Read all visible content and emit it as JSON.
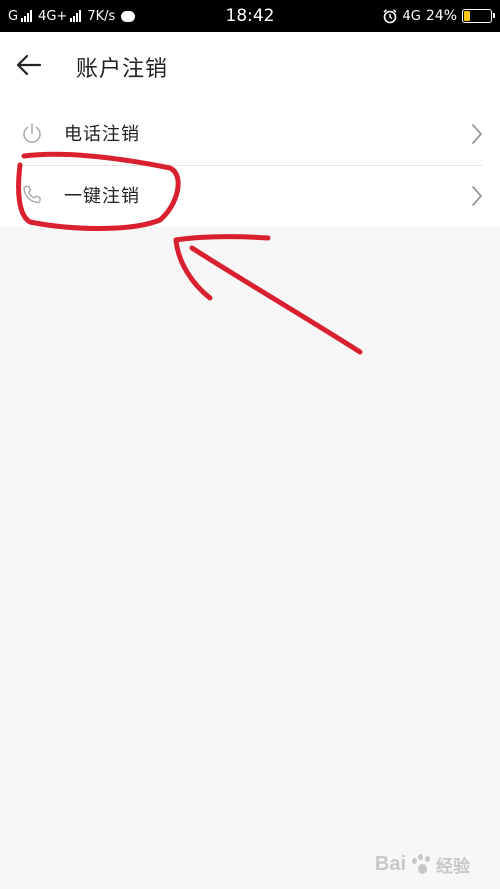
{
  "status_bar": {
    "carrier1": "G",
    "network": "4G+",
    "speed": "7K/s",
    "time": "18:42",
    "network_right": "4G",
    "battery_percent": "24%",
    "battery_level": 0.24,
    "battery_color": "#f5c518"
  },
  "header": {
    "title": "账户注销",
    "back_icon": "arrow-left-icon"
  },
  "list": {
    "items": [
      {
        "label": "电话注销",
        "icon": "power-icon"
      },
      {
        "label": "一键注销",
        "icon": "phone-icon"
      }
    ]
  },
  "annotation": {
    "color": "#d8202e"
  },
  "watermark": {
    "text_latin": "Bai",
    "text_cn": "经验"
  }
}
